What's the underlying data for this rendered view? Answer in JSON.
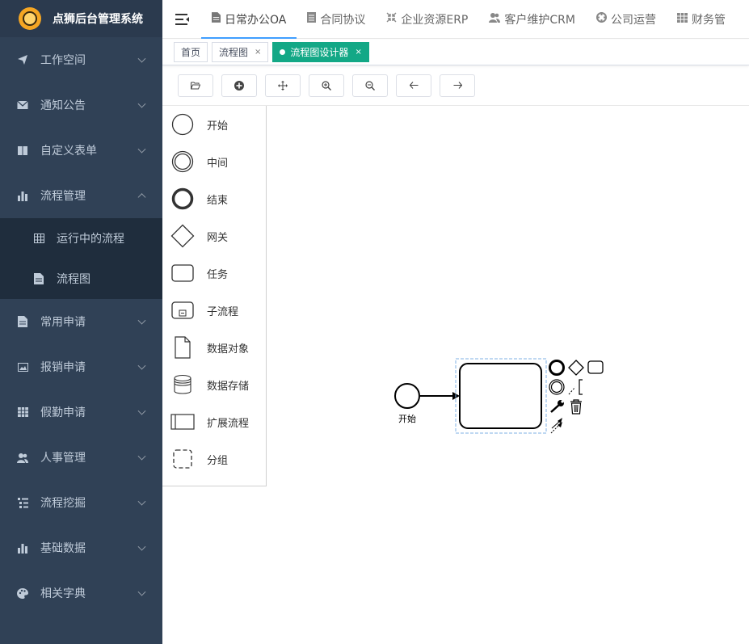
{
  "app": {
    "title": "点狮后台管理系统"
  },
  "sidebar": {
    "items": [
      {
        "label": "工作空间",
        "icon": "send-icon"
      },
      {
        "label": "通知公告",
        "icon": "mail-icon"
      },
      {
        "label": "自定义表单",
        "icon": "book-icon"
      },
      {
        "label": "流程管理",
        "icon": "bar-chart-icon",
        "expanded": true,
        "children": [
          {
            "label": "运行中的流程",
            "icon": "table-icon"
          },
          {
            "label": "流程图",
            "icon": "document-icon"
          }
        ]
      },
      {
        "label": "常用申请",
        "icon": "document-icon"
      },
      {
        "label": "报销申请",
        "icon": "image-icon"
      },
      {
        "label": "假勤申请",
        "icon": "grid-icon"
      },
      {
        "label": "人事管理",
        "icon": "users-icon"
      },
      {
        "label": "流程挖掘",
        "icon": "tree-list-icon"
      },
      {
        "label": "基础数据",
        "icon": "bar-chart-icon"
      },
      {
        "label": "相关字典",
        "icon": "palette-icon"
      }
    ]
  },
  "navbar": {
    "tabs": [
      {
        "label": "日常办公OA",
        "icon": "document-icon",
        "active": true
      },
      {
        "label": "合同协议",
        "icon": "server-icon"
      },
      {
        "label": "企业资源ERP",
        "icon": "compress-icon"
      },
      {
        "label": "客户维护CRM",
        "icon": "users-icon"
      },
      {
        "label": "公司运营",
        "icon": "target-icon"
      },
      {
        "label": "财务管",
        "icon": "grid-icon"
      }
    ]
  },
  "tags": [
    {
      "label": "首页",
      "closable": false
    },
    {
      "label": "流程图",
      "closable": true,
      "close": "×"
    },
    {
      "label": "流程图设计器",
      "closable": true,
      "active": true,
      "close": "×"
    }
  ],
  "toolbar": {
    "buttons": [
      {
        "icon": "folder-open-icon"
      },
      {
        "icon": "plus-circle-icon"
      },
      {
        "icon": "move-icon"
      },
      {
        "icon": "zoom-in-icon"
      },
      {
        "icon": "zoom-out-icon"
      },
      {
        "icon": "arrow-left-icon"
      },
      {
        "icon": "arrow-right-icon"
      }
    ]
  },
  "palette": {
    "items": [
      {
        "label": "开始",
        "shape": "start-event-icon"
      },
      {
        "label": "中间",
        "shape": "intermediate-event-icon"
      },
      {
        "label": "结束",
        "shape": "end-event-icon"
      },
      {
        "label": "网关",
        "shape": "gateway-icon"
      },
      {
        "label": "任务",
        "shape": "task-icon"
      },
      {
        "label": "子流程",
        "shape": "subprocess-icon"
      },
      {
        "label": "数据对象",
        "shape": "data-object-icon"
      },
      {
        "label": "数据存储",
        "shape": "data-store-icon"
      },
      {
        "label": "扩展流程",
        "shape": "pool-icon"
      },
      {
        "label": "分组",
        "shape": "group-icon"
      }
    ]
  },
  "diagram": {
    "start_label": "开始"
  },
  "colors": {
    "sidebar_bg": "#304156",
    "submenu_bg": "#1f2d3d",
    "accent_tag": "#13a886",
    "tab_underline": "#409eff"
  }
}
